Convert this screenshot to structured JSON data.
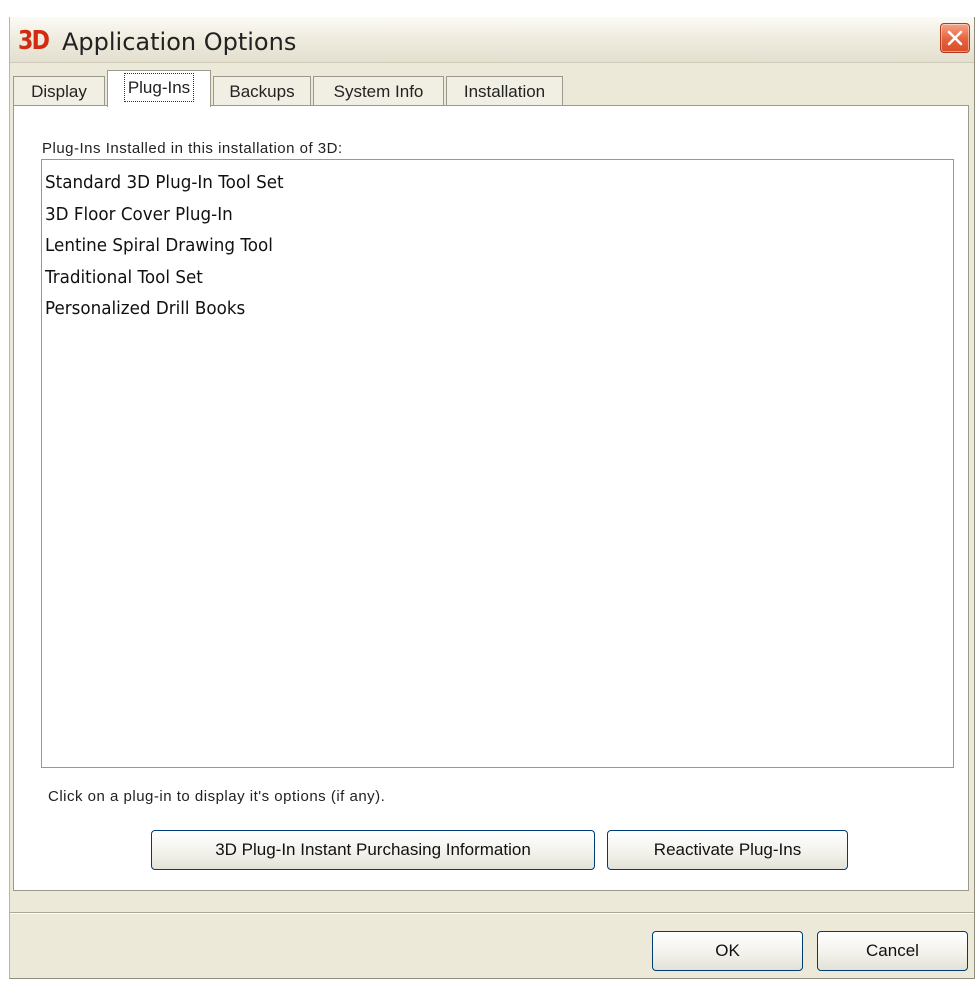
{
  "window": {
    "title": "Application Options",
    "logo_text": "3D"
  },
  "tabs": [
    {
      "label": "Display"
    },
    {
      "label": "Plug-Ins"
    },
    {
      "label": "Backups"
    },
    {
      "label": "System Info"
    },
    {
      "label": "Installation"
    }
  ],
  "active_tab": "Plug-Ins",
  "plugins_panel": {
    "list_label": "Plug-Ins Installed in this installation of 3D:",
    "items": [
      "Standard 3D Plug-In Tool Set",
      "3D Floor Cover Plug-In",
      "Lentine Spiral Drawing Tool",
      "Traditional Tool Set",
      "Personalized Drill Books"
    ],
    "hint": "Click on a plug-in to display it's options (if any).",
    "purchase_button_label": "3D Plug-In Instant Purchasing Information",
    "reactivate_button_label": "Reactivate Plug-Ins"
  },
  "footer": {
    "ok_label": "OK",
    "cancel_label": "Cancel"
  },
  "colors": {
    "logo": "#d32a12",
    "close_button": "#e5623c",
    "dialog_background": "#ece9d8",
    "button_border": "#003c74"
  },
  "icons": {
    "close": "close-icon"
  }
}
